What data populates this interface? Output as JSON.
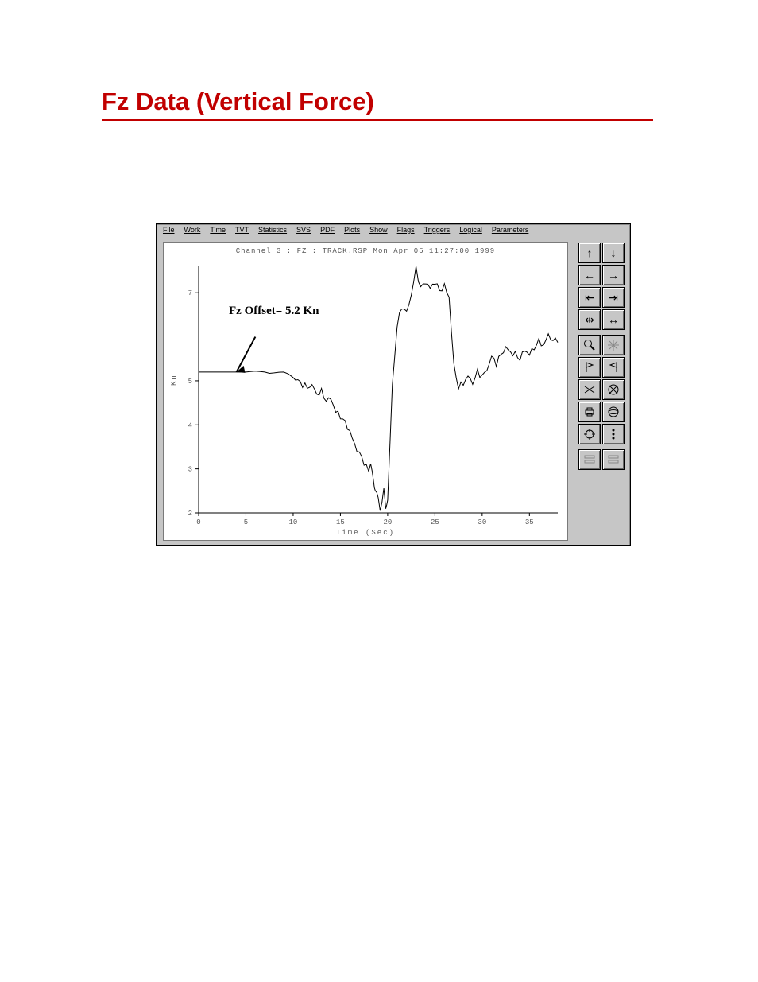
{
  "page": {
    "heading": "Fz Data (Vertical Force)"
  },
  "app": {
    "menu": [
      "File",
      "Work",
      "Time",
      "TVT",
      "Statistics",
      "SVS",
      "PDF",
      "Plots",
      "Show",
      "Flags",
      "Triggers",
      "Logical",
      "Parameters"
    ],
    "plot_title": "Channel 3 : FZ : TRACK.RSP Mon Apr 05 11:27:00 1999",
    "annotation": "Fz Offset= 5.2 Kn",
    "ylabel": "Kn",
    "xlabel": "Time (Sec)",
    "tool_names": [
      "arrow-up-icon",
      "arrow-down-icon",
      "arrow-left-icon",
      "arrow-right-icon",
      "goto-start-icon",
      "goto-end-icon",
      "fit-width-icon",
      "stretch-icon",
      "zoom-icon",
      "reticle-icon",
      "flag-left-icon",
      "flag-right-icon",
      "cut-icon",
      "no-entry-icon",
      "print-icon",
      "disk-icon",
      "target-icon",
      "more-icon",
      "settings1-icon",
      "settings2-icon"
    ]
  },
  "chart_data": {
    "type": "line",
    "title": "Channel 3 : FZ : TRACK.RSP Mon Apr 05 11:27:00 1999",
    "xlabel": "Time (Sec)",
    "ylabel": "Kn",
    "xlim": [
      0,
      38
    ],
    "ylim": [
      2,
      7.6
    ],
    "x_ticks": [
      0,
      5,
      10,
      15,
      20,
      25,
      30,
      35
    ],
    "y_ticks": [
      2,
      3,
      4,
      5,
      7
    ],
    "annotation": {
      "text": "Fz Offset= 5.2 Kn",
      "x": 6.5,
      "y": 6.2,
      "arrow_to": {
        "x": 4,
        "y": 5.2
      }
    },
    "series": [
      {
        "name": "Fz",
        "x": [
          0,
          4,
          5,
          6,
          7,
          8,
          9,
          10,
          10.5,
          11,
          11.5,
          12,
          12.5,
          13,
          13.5,
          14,
          14.5,
          15,
          15.5,
          16,
          16.5,
          17,
          17.5,
          18,
          18.2,
          18.5,
          18.7,
          19,
          19.2,
          19.4,
          19.6,
          19.8,
          20,
          20.5,
          21,
          21.5,
          22,
          22.5,
          23,
          23.5,
          24,
          24.5,
          25,
          25.5,
          26,
          26.5,
          27,
          27.5,
          28,
          28.5,
          29,
          29.5,
          30,
          30.5,
          31,
          31.5,
          32,
          32.5,
          33,
          33.5,
          34,
          34.5,
          35,
          35.5,
          36,
          36.5,
          37,
          37.5,
          38
        ],
        "values": [
          5.2,
          5.2,
          5.2,
          5.22,
          5.2,
          5.18,
          5.15,
          5.08,
          5.0,
          4.92,
          4.85,
          4.9,
          4.7,
          4.75,
          4.55,
          4.6,
          4.3,
          4.2,
          4.05,
          3.85,
          3.55,
          3.35,
          3.15,
          2.95,
          3.1,
          2.75,
          2.55,
          2.35,
          2.05,
          2.25,
          2.55,
          2.1,
          2.3,
          4.9,
          6.25,
          6.7,
          6.55,
          6.95,
          7.55,
          7.1,
          7.25,
          7.1,
          7.25,
          7.05,
          7.15,
          6.9,
          5.35,
          4.85,
          4.95,
          5.1,
          4.95,
          5.2,
          5.1,
          5.25,
          5.55,
          5.4,
          5.6,
          5.75,
          5.65,
          5.6,
          5.5,
          5.7,
          5.6,
          5.75,
          5.9,
          5.8,
          6.05,
          5.9,
          5.95
        ]
      }
    ]
  }
}
